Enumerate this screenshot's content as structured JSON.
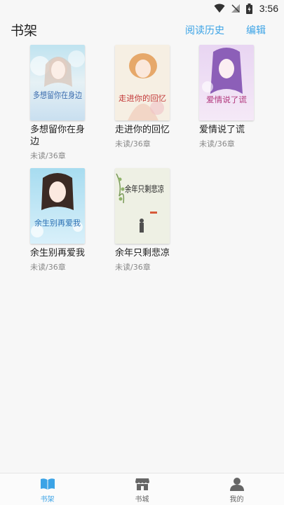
{
  "status_bar": {
    "time": "3:56"
  },
  "header": {
    "title": "书架",
    "history_label": "阅读历史",
    "edit_label": "编辑"
  },
  "books": [
    {
      "title": "多想留你在身边",
      "progress": "未读/36章",
      "cover_text": "多想留你在身边"
    },
    {
      "title": "走进你的回忆",
      "progress": "未读/36章",
      "cover_text": "走进你的回忆"
    },
    {
      "title": "爱情说了谎",
      "progress": "未读/36章",
      "cover_text": "爱情说了谎"
    },
    {
      "title": "余生别再爱我",
      "progress": "未读/36章",
      "cover_text": "余生别再爱我"
    },
    {
      "title": "余年只剩悲凉",
      "progress": "未读/36章",
      "cover_text": "余年只剩悲凉"
    }
  ],
  "bottom_nav": [
    {
      "label": "书架",
      "icon": "book-open-icon",
      "active": true
    },
    {
      "label": "书城",
      "icon": "store-icon",
      "active": false
    },
    {
      "label": "我的",
      "icon": "person-icon",
      "active": false
    }
  ],
  "colors": {
    "accent": "#3ba3e6",
    "background": "#f7f7f7"
  }
}
